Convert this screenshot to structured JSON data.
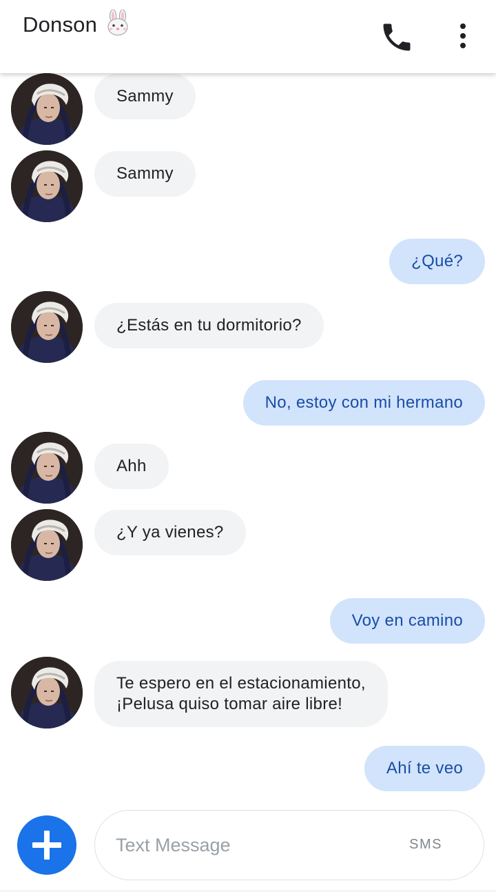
{
  "header": {
    "title": "Donson",
    "title_emoji_icon": "rabbit-face-icon",
    "call_icon": "phone-icon",
    "more_icon": "more-vert-icon"
  },
  "messages": [
    {
      "direction": "incoming",
      "text": "Sammy"
    },
    {
      "direction": "incoming",
      "text": "Sammy"
    },
    {
      "direction": "outgoing",
      "text": "¿Qué?"
    },
    {
      "direction": "incoming",
      "text": "¿Estás en tu dormitorio?"
    },
    {
      "direction": "outgoing",
      "text": "No, estoy con mi hermano"
    },
    {
      "direction": "incoming",
      "text": "Ahh"
    },
    {
      "direction": "incoming",
      "text": "¿Y ya vienes?"
    },
    {
      "direction": "outgoing",
      "text": "Voy en camino"
    },
    {
      "direction": "incoming",
      "text": "Te espero en el estacionamiento,\n¡Pelusa quiso tomar aire libre!"
    },
    {
      "direction": "outgoing",
      "text": "Ahí te veo"
    }
  ],
  "composer": {
    "placeholder": "Text Message",
    "mode_label": "SMS",
    "add_icon": "plus-icon"
  },
  "colors": {
    "incoming_bubble": "#f1f3f4",
    "outgoing_bubble": "#d2e3fc",
    "outgoing_text": "#174ea6",
    "accent": "#1a73e8"
  }
}
